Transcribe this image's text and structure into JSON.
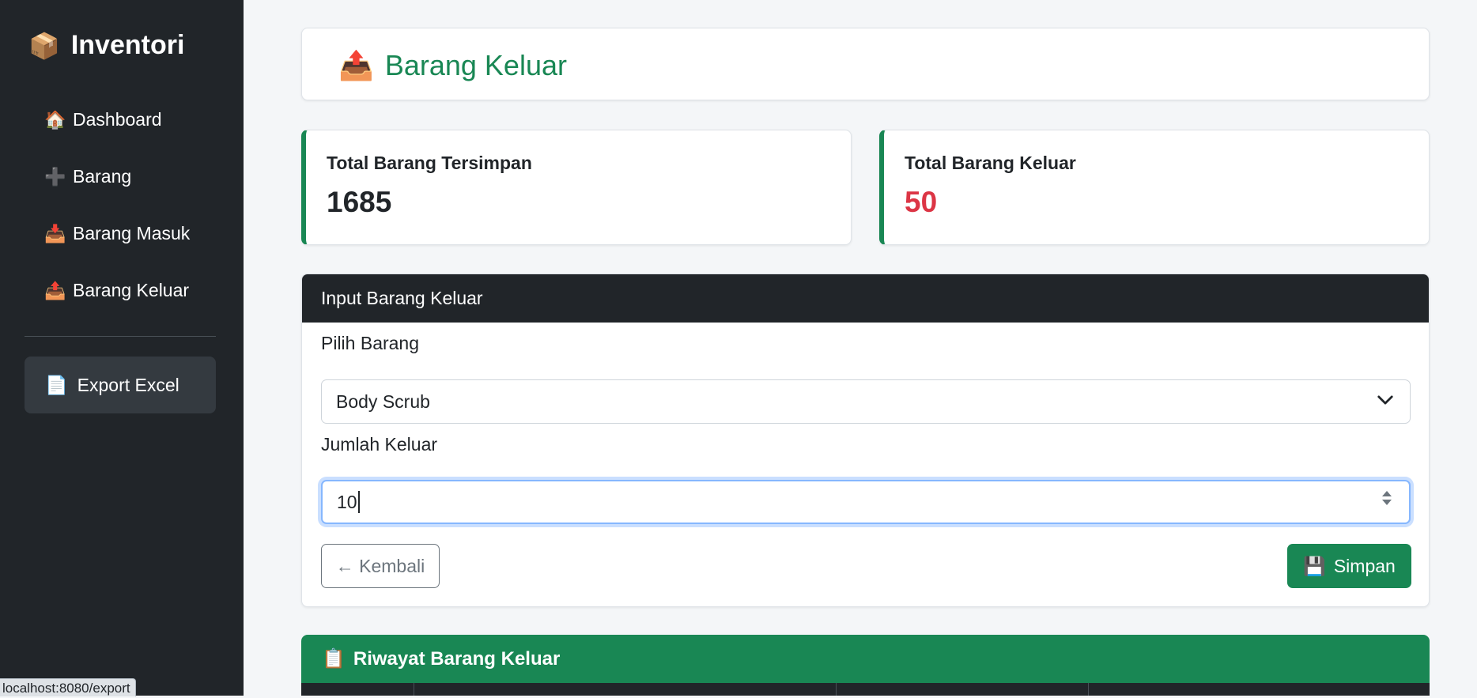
{
  "sidebar": {
    "brand": "Inventori",
    "brand_icon": "📦",
    "items": [
      {
        "label": "Dashboard",
        "icon": "🏠"
      },
      {
        "label": "Barang",
        "icon": "➕"
      },
      {
        "label": "Barang Masuk",
        "icon": "📥"
      },
      {
        "label": "Barang Keluar",
        "icon": "📤"
      }
    ],
    "export_label": "Export Excel",
    "export_icon": "📄"
  },
  "status_bar_url": "localhost:8080/export",
  "header": {
    "title": "Barang Keluar",
    "icon": "📤"
  },
  "stats": [
    {
      "label": "Total Barang Tersimpan",
      "value": "1685"
    },
    {
      "label": "Total Barang Keluar",
      "value": "50"
    }
  ],
  "form": {
    "title": "Input Barang Keluar",
    "select_label": "Pilih Barang",
    "select_value": "Body Scrub",
    "qty_label": "Jumlah Keluar",
    "qty_value": "10",
    "back_label": "← Kembali",
    "save_label": "Simpan",
    "save_icon": "💾"
  },
  "history": {
    "title": "Riwayat Barang Keluar",
    "icon": "📋"
  },
  "colors": {
    "sidebar_bg": "#212529",
    "accent_green": "#198754",
    "danger_red": "#dc3545",
    "focus_blue": "#86b7fe"
  }
}
